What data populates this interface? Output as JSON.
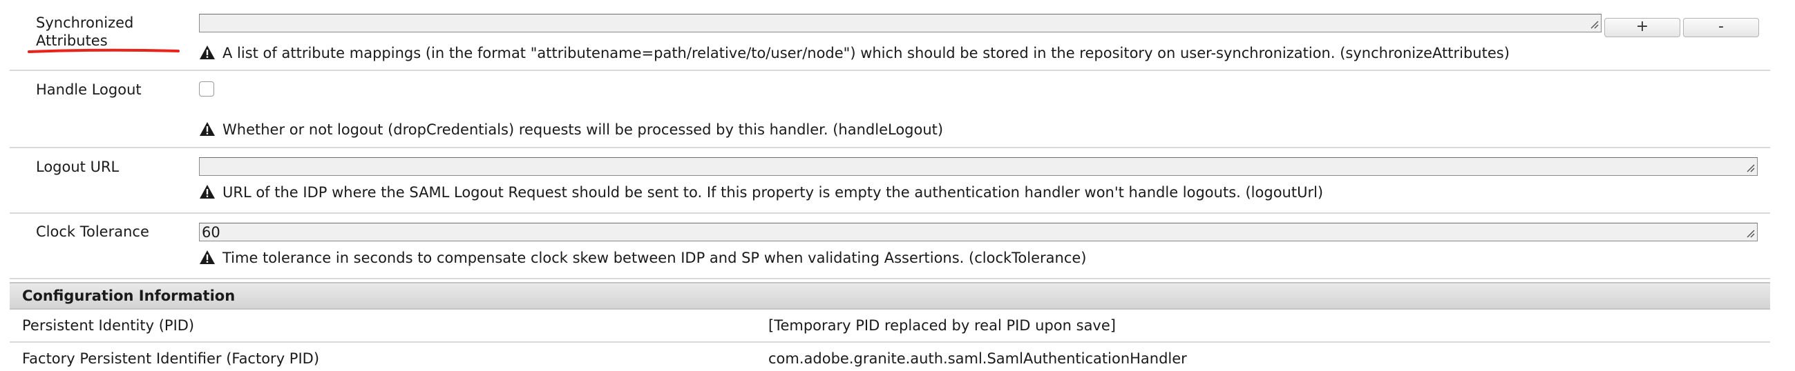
{
  "properties": [
    {
      "label_line1": "Synchronized",
      "label_line2": "Attributes",
      "value": "",
      "add_label": "+",
      "remove_label": "-",
      "description": "A list of attribute mappings (in the format \"attributename=path/relative/to/user/node\") which should be stored in the repository on user-synchronization. (synchronizeAttributes)"
    },
    {
      "label": "Handle Logout",
      "checked": false,
      "description": "Whether or not logout (dropCredentials) requests will be processed by this handler. (handleLogout)"
    },
    {
      "label": "Logout URL",
      "value": "",
      "description": "URL of the IDP where the SAML Logout Request should be sent to. If this property is empty the authentication handler won't handle logouts. (logoutUrl)"
    },
    {
      "label": "Clock Tolerance",
      "value": "60",
      "description": "Time tolerance in seconds to compensate clock skew between IDP and SP when validating Assertions. (clockTolerance)"
    }
  ],
  "config_info": {
    "title": "Configuration Information",
    "rows": [
      {
        "key": "Persistent Identity (PID)",
        "value": "[Temporary PID replaced by real PID upon save]"
      },
      {
        "key": "Factory Persistent Identifier (Factory PID)",
        "value": "com.adobe.granite.auth.saml.SamlAuthenticationHandler"
      }
    ]
  },
  "colors": {
    "annotation_underline": "#e8231b",
    "section_header_bg": "#dcdcdc",
    "field_bg": "#f0f0f0"
  },
  "icons": {
    "warning": "warning-icon",
    "resize": "resize-grip-icon"
  }
}
